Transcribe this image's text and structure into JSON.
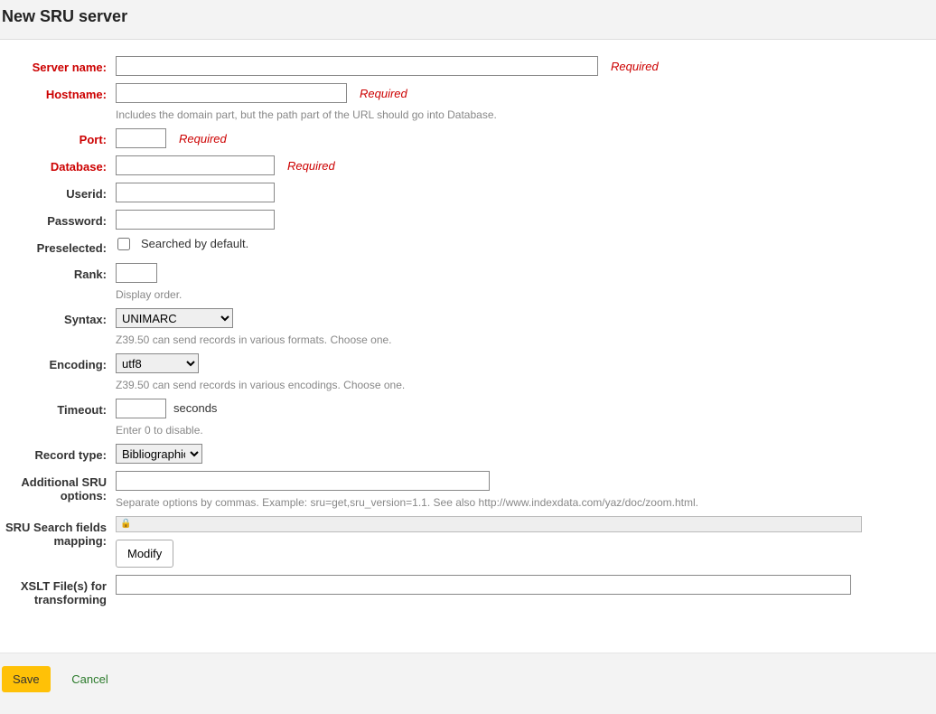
{
  "header": {
    "title": "New SRU server"
  },
  "required_text": "Required",
  "fields": {
    "server_name": {
      "label": "Server name:"
    },
    "hostname": {
      "label": "Hostname:",
      "hint": "Includes the domain part, but the path part of the URL should go into Database."
    },
    "port": {
      "label": "Port:"
    },
    "database": {
      "label": "Database:"
    },
    "userid": {
      "label": "Userid:"
    },
    "password": {
      "label": "Password:"
    },
    "preselected": {
      "label": "Preselected:",
      "checkbox_label": "Searched by default."
    },
    "rank": {
      "label": "Rank:",
      "hint": "Display order."
    },
    "syntax": {
      "label": "Syntax:",
      "selected": "UNIMARC",
      "hint": "Z39.50 can send records in various formats. Choose one."
    },
    "encoding": {
      "label": "Encoding:",
      "selected": "utf8",
      "hint": "Z39.50 can send records in various encodings. Choose one."
    },
    "timeout": {
      "label": "Timeout:",
      "unit": "seconds",
      "hint": "Enter 0 to disable."
    },
    "record_type": {
      "label": "Record type:",
      "selected": "Bibliographic"
    },
    "additional_sru": {
      "label": "Additional SRU options:",
      "hint": "Separate options by commas. Example: sru=get,sru_version=1.1. See also http://www.indexdata.com/yaz/doc/zoom.html."
    },
    "sru_mapping": {
      "label": "SRU Search fields mapping:",
      "modify_label": "Modify"
    },
    "xslt": {
      "label": "XSLT File(s) for transforming"
    }
  },
  "actions": {
    "save": "Save",
    "cancel": "Cancel"
  }
}
